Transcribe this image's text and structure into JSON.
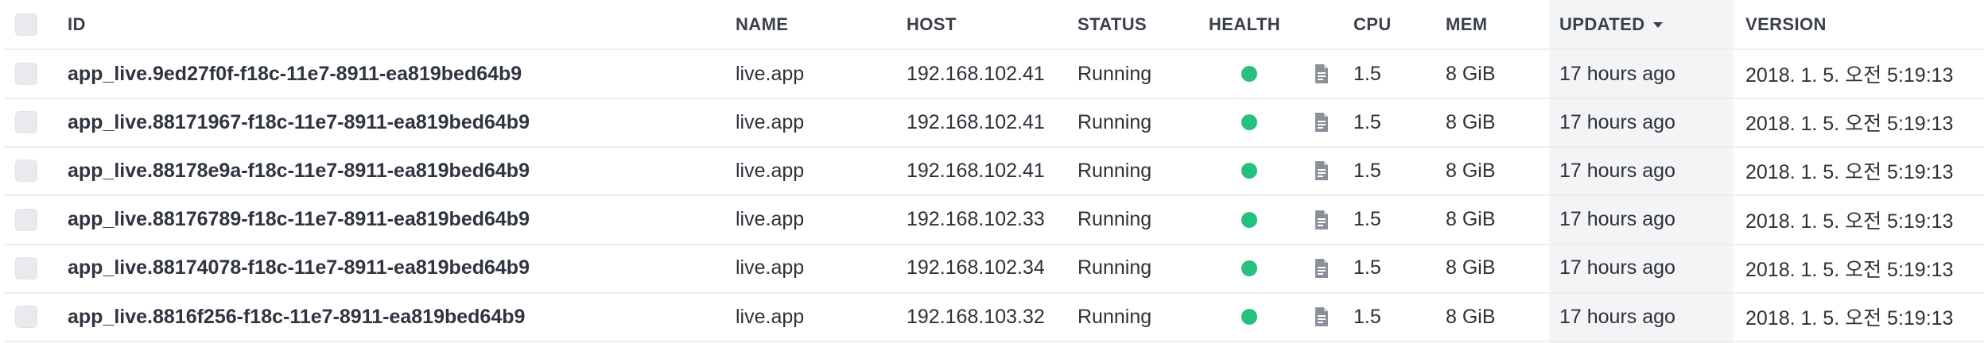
{
  "colors": {
    "health_ok": "#27c07d",
    "sorted_column_bg": "#f3f4f6",
    "row_divider": "#eceef2"
  },
  "header": {
    "id": "ID",
    "name": "NAME",
    "host": "HOST",
    "status": "STATUS",
    "health": "HEALTH",
    "cpu": "CPU",
    "mem": "MEM",
    "updated": "UPDATED",
    "version": "VERSION",
    "sort_icon": "caret-down-icon"
  },
  "rows": [
    {
      "id": "app_live.9ed27f0f-f18c-11e7-8911-ea819bed64b9",
      "name": "live.app",
      "host": "192.168.102.41",
      "status": "Running",
      "health": "healthy",
      "cpu": "1.5",
      "mem": "8 GiB",
      "updated": "17 hours ago",
      "version": "2018. 1. 5. 오전 5:19:13"
    },
    {
      "id": "app_live.88171967-f18c-11e7-8911-ea819bed64b9",
      "name": "live.app",
      "host": "192.168.102.41",
      "status": "Running",
      "health": "healthy",
      "cpu": "1.5",
      "mem": "8 GiB",
      "updated": "17 hours ago",
      "version": "2018. 1. 5. 오전 5:19:13"
    },
    {
      "id": "app_live.88178e9a-f18c-11e7-8911-ea819bed64b9",
      "name": "live.app",
      "host": "192.168.102.41",
      "status": "Running",
      "health": "healthy",
      "cpu": "1.5",
      "mem": "8 GiB",
      "updated": "17 hours ago",
      "version": "2018. 1. 5. 오전 5:19:13"
    },
    {
      "id": "app_live.88176789-f18c-11e7-8911-ea819bed64b9",
      "name": "live.app",
      "host": "192.168.102.33",
      "status": "Running",
      "health": "healthy",
      "cpu": "1.5",
      "mem": "8 GiB",
      "updated": "17 hours ago",
      "version": "2018. 1. 5. 오전 5:19:13"
    },
    {
      "id": "app_live.88174078-f18c-11e7-8911-ea819bed64b9",
      "name": "live.app",
      "host": "192.168.102.34",
      "status": "Running",
      "health": "healthy",
      "cpu": "1.5",
      "mem": "8 GiB",
      "updated": "17 hours ago",
      "version": "2018. 1. 5. 오전 5:19:13"
    },
    {
      "id": "app_live.8816f256-f18c-11e7-8911-ea819bed64b9",
      "name": "live.app",
      "host": "192.168.103.32",
      "status": "Running",
      "health": "healthy",
      "cpu": "1.5",
      "mem": "8 GiB",
      "updated": "17 hours ago",
      "version": "2018. 1. 5. 오전 5:19:13"
    }
  ]
}
